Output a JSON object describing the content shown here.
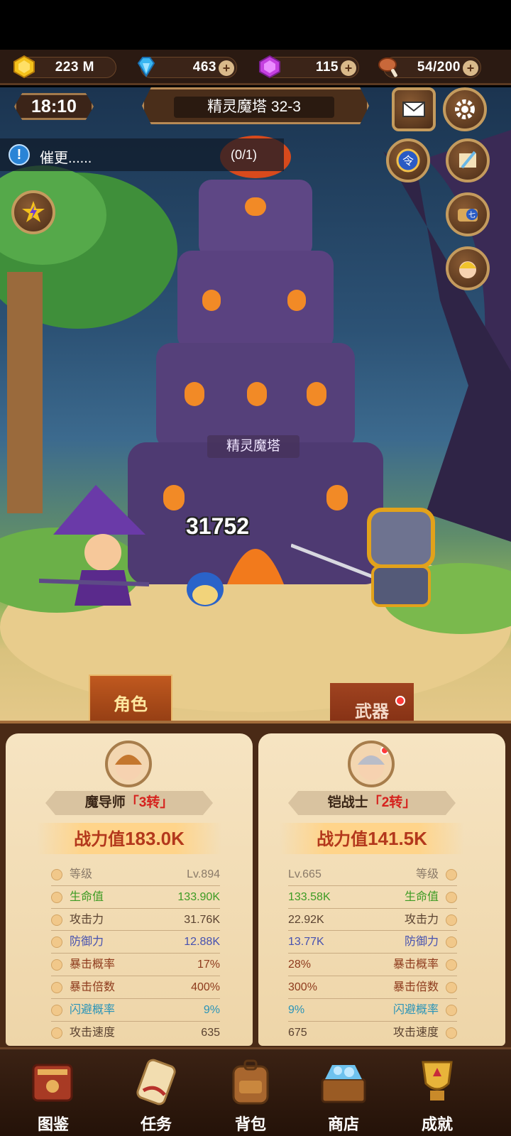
{
  "resources": {
    "gold": {
      "value": "223 M",
      "icon": "gold-coin-icon"
    },
    "diamond": {
      "value": "463",
      "icon": "blue-diamond-icon"
    },
    "gem": {
      "value": "115",
      "icon": "purple-gem-icon"
    },
    "stamina": {
      "value": "54/200",
      "icon": "meat-icon"
    }
  },
  "hud": {
    "time": "18:10",
    "stage": "精灵魔塔 32-3",
    "quest_text": "催更......",
    "quest_progress": "(0/1)"
  },
  "scene": {
    "tower_label": "精灵魔塔",
    "damage": "31752"
  },
  "tabs": {
    "left": "角色",
    "right": "武器"
  },
  "left_page": {
    "class_name": "魔导师",
    "tier": "「3转」",
    "power_label": "战力值",
    "power_value": "183.0K",
    "stats": [
      {
        "label": "等级",
        "value": "Lv.894"
      },
      {
        "label": "生命值",
        "value": "133.90K"
      },
      {
        "label": "攻击力",
        "value": "31.76K"
      },
      {
        "label": "防御力",
        "value": "12.88K"
      },
      {
        "label": "暴击概率",
        "value": "17%"
      },
      {
        "label": "暴击倍数",
        "value": "400%"
      },
      {
        "label": "闪避概率",
        "value": "9%"
      },
      {
        "label": "攻击速度",
        "value": "635"
      }
    ]
  },
  "right_page": {
    "class_name": "铠战士",
    "tier": "「2转」",
    "power_label": "战力值",
    "power_value": "141.5K",
    "stats": [
      {
        "label": "等级",
        "value": "Lv.665"
      },
      {
        "label": "生命值",
        "value": "133.58K"
      },
      {
        "label": "攻击力",
        "value": "22.92K"
      },
      {
        "label": "防御力",
        "value": "13.77K"
      },
      {
        "label": "暴击概率",
        "value": "28%"
      },
      {
        "label": "暴击倍数",
        "value": "300%"
      },
      {
        "label": "闪避概率",
        "value": "9%"
      },
      {
        "label": "攻击速度",
        "value": "675"
      }
    ]
  },
  "nav": [
    {
      "label": "图鉴",
      "icon": "codex-book-icon"
    },
    {
      "label": "任务",
      "icon": "quest-scroll-icon"
    },
    {
      "label": "背包",
      "icon": "backpack-icon"
    },
    {
      "label": "商店",
      "icon": "shop-chest-icon"
    },
    {
      "label": "成就",
      "icon": "achievement-trophy-icon"
    }
  ],
  "colors": {
    "power": "#b3381c",
    "tier": "#d6221e",
    "hp": "#3d9b23",
    "defense": "#4651b0",
    "crit": "#8e3b1d",
    "dodge": "#2a94b8"
  }
}
